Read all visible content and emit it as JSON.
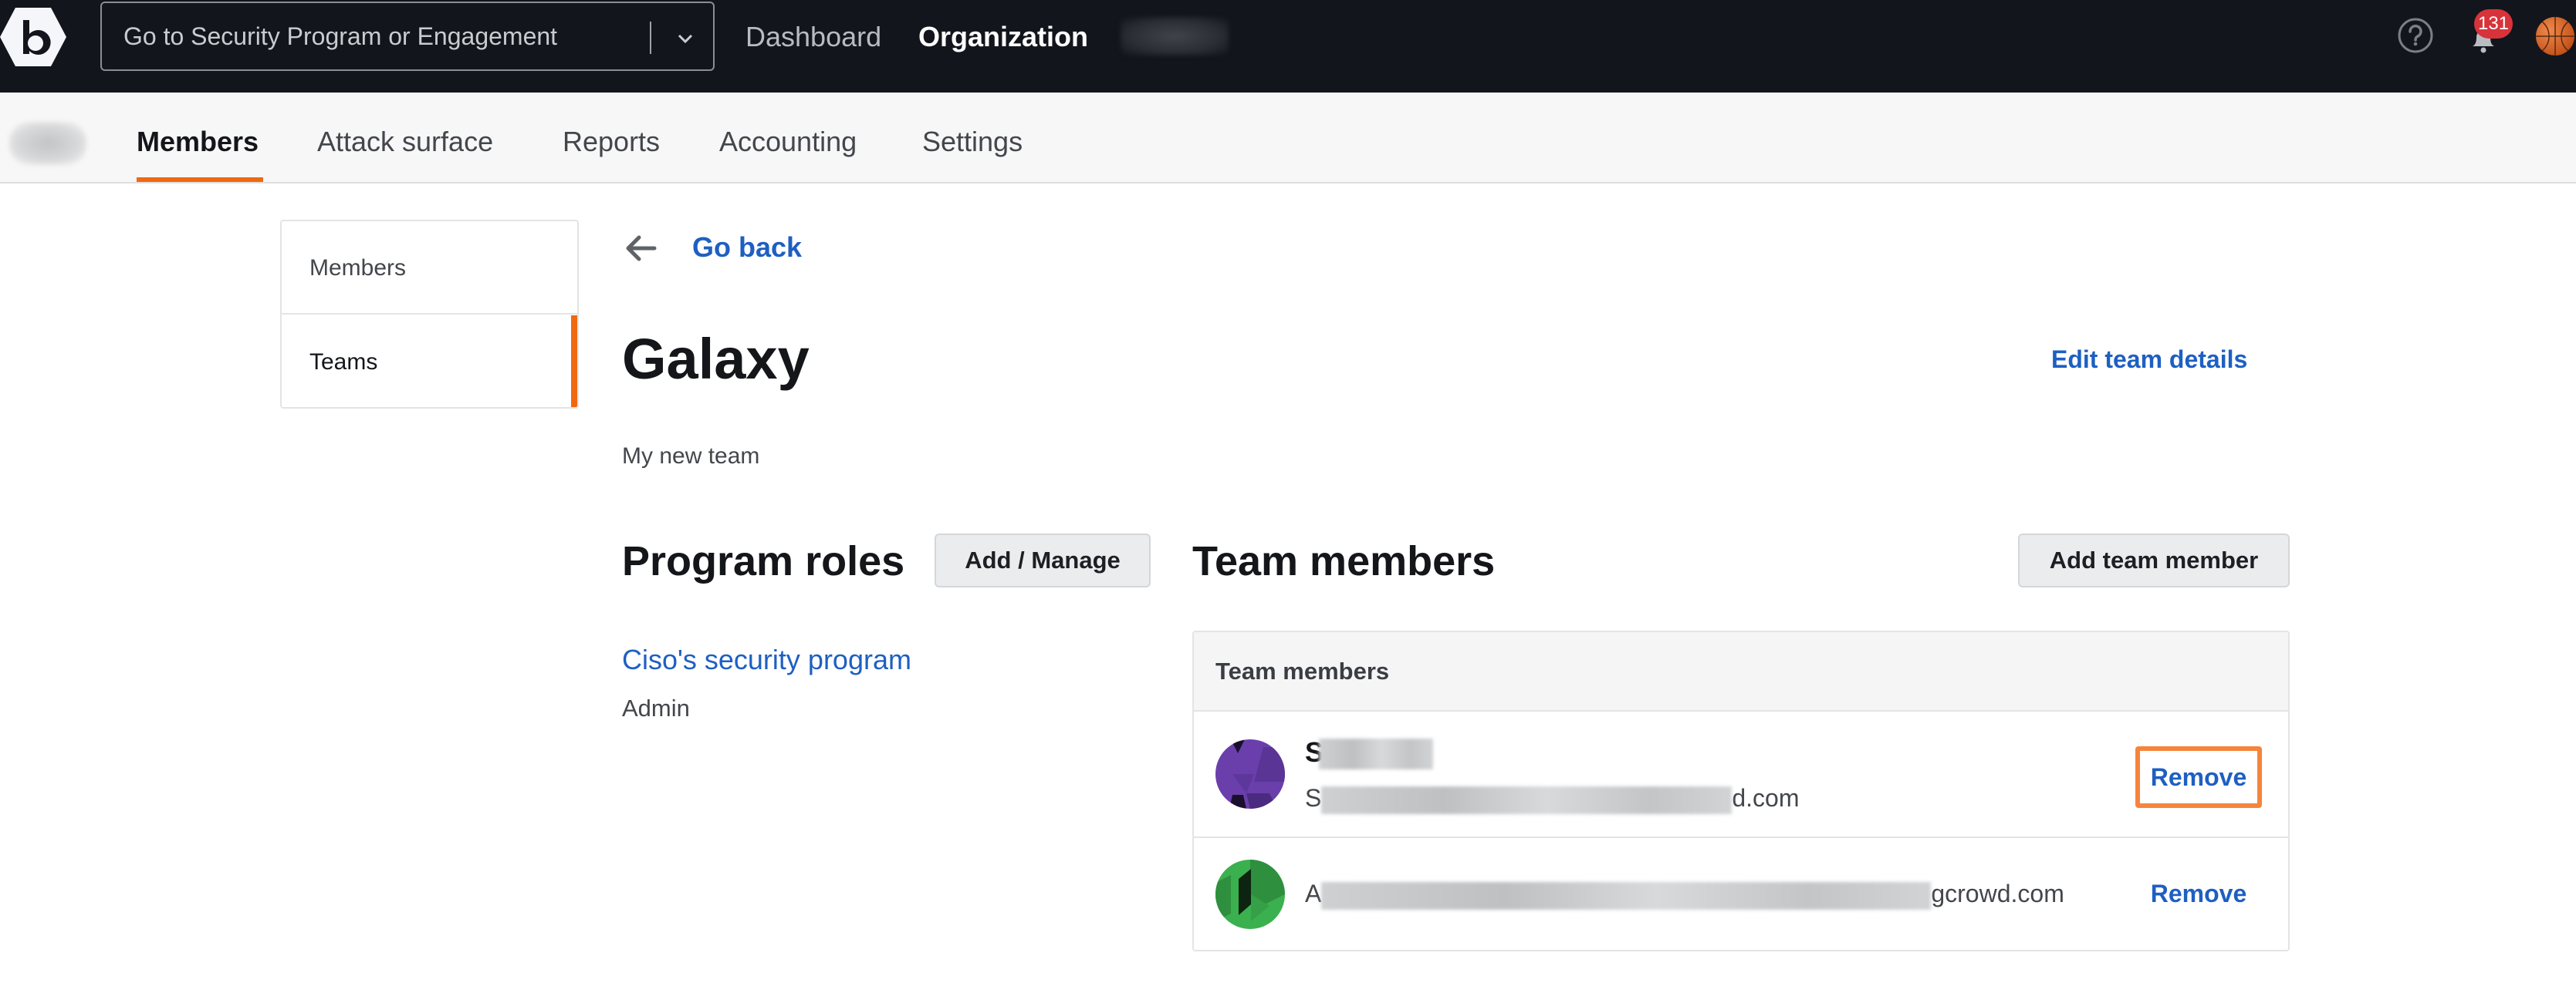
{
  "topbar": {
    "logo_letter": "b",
    "search_placeholder": "Go to Security Program or Engagement",
    "nav": [
      {
        "label": "Dashboard",
        "active": false
      },
      {
        "label": "Organization",
        "active": true
      }
    ],
    "notifications_count": "131",
    "icons": {
      "help": "help-circle-icon",
      "notifications": "bell-icon",
      "avatar": "basketball-avatar"
    }
  },
  "subnav": {
    "tabs": [
      {
        "label": "Members",
        "active": true
      },
      {
        "label": "Attack surface",
        "active": false
      },
      {
        "label": "Reports",
        "active": false
      },
      {
        "label": "Accounting",
        "active": false
      },
      {
        "label": "Settings",
        "active": false
      }
    ]
  },
  "sidebar": {
    "items": [
      {
        "label": "Members",
        "active": false
      },
      {
        "label": "Teams",
        "active": true
      }
    ]
  },
  "main": {
    "go_back": "Go back",
    "team_name": "Galaxy",
    "edit_team_details": "Edit team details",
    "team_description": "My new team",
    "program_roles": {
      "heading": "Program roles",
      "button": "Add / Manage",
      "items": [
        {
          "program": "Ciso's security program",
          "role": "Admin"
        }
      ]
    },
    "team_members": {
      "heading": "Team members",
      "button": "Add team member",
      "table_header": "Team members",
      "rows": [
        {
          "name_visible": "S",
          "email_prefix": "S",
          "email_suffix": "d.com",
          "action": "Remove",
          "avatar_color": "#6a3fac",
          "focused": true
        },
        {
          "name_visible": "",
          "email_prefix": "A",
          "email_suffix": "gcrowd.com",
          "action": "Remove",
          "avatar_color": "#3bb04f",
          "focused": false
        }
      ]
    }
  },
  "colors": {
    "topbar_bg": "#12151c",
    "accent_orange": "#f0690f",
    "link_blue": "#1e5fc2",
    "focus_outline": "#f5853b",
    "badge_red": "#d8333a"
  }
}
